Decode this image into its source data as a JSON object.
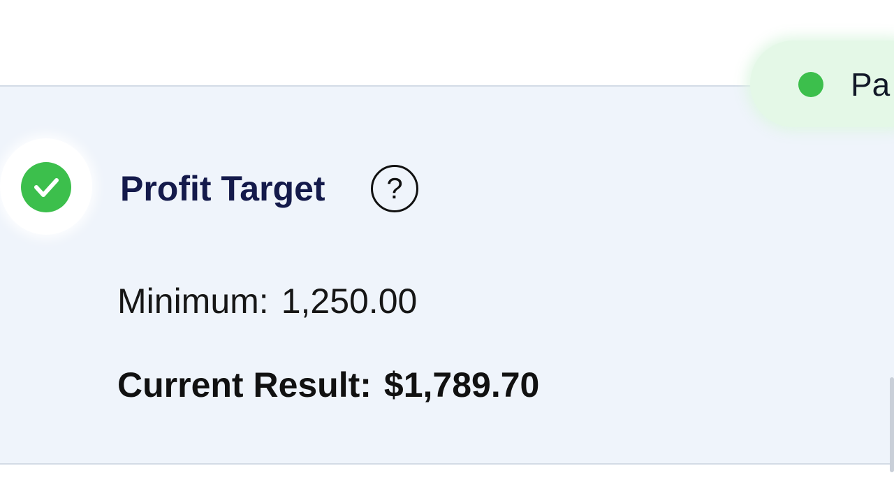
{
  "status": {
    "label": "Pa",
    "color": "#3cbf4c"
  },
  "rule": {
    "icon": "check-circle-icon",
    "title": "Profit Target",
    "help_icon": "question-circle-icon",
    "help_glyph": "?"
  },
  "minimum": {
    "label": "Minimum:",
    "value": "1,250.00"
  },
  "current": {
    "label": "Current Result:",
    "value": "$1,789.70"
  },
  "colors": {
    "success": "#3cbf4c",
    "title": "#141a4b",
    "card_background": "#eff4fb"
  }
}
